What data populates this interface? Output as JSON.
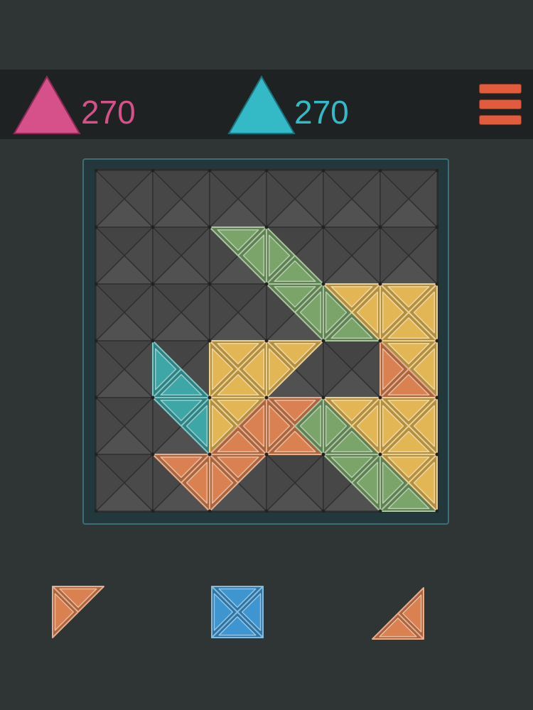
{
  "scores": {
    "player1": {
      "value": "270",
      "color": "#d6508a",
      "icon": "pink-triangle-icon"
    },
    "player2": {
      "value": "270",
      "color": "#34b9c6",
      "icon": "teal-triangle-icon"
    }
  },
  "menu": {
    "icon": "hamburger-menu-icon",
    "color": "#e05c3c"
  },
  "board": {
    "rows": 6,
    "cols": 6,
    "empty_color": "#4a4a4a",
    "colors": {
      "G": "#7aa46a",
      "Y": "#e2b654",
      "O": "#d98150",
      "T": "#3ea6a6"
    },
    "filled": [
      {
        "r": 1,
        "c": 2,
        "t": "top",
        "col": "G"
      },
      {
        "r": 1,
        "c": 2,
        "t": "right",
        "col": "G"
      },
      {
        "r": 1,
        "c": 3,
        "t": "left",
        "col": "G"
      },
      {
        "r": 1,
        "c": 3,
        "t": "bottom",
        "col": "G"
      },
      {
        "r": 2,
        "c": 3,
        "t": "top",
        "col": "G"
      },
      {
        "r": 2,
        "c": 3,
        "t": "right",
        "col": "G"
      },
      {
        "r": 2,
        "c": 4,
        "t": "left",
        "col": "G"
      },
      {
        "r": 2,
        "c": 4,
        "t": "bottom",
        "col": "G"
      },
      {
        "r": 2,
        "c": 4,
        "t": "top",
        "col": "Y"
      },
      {
        "r": 2,
        "c": 4,
        "t": "right",
        "col": "Y"
      },
      {
        "r": 2,
        "c": 5,
        "t": "top",
        "col": "Y"
      },
      {
        "r": 2,
        "c": 5,
        "t": "right",
        "col": "Y"
      },
      {
        "r": 2,
        "c": 5,
        "t": "bottom",
        "col": "Y"
      },
      {
        "r": 2,
        "c": 5,
        "t": "left",
        "col": "Y"
      },
      {
        "r": 3,
        "c": 1,
        "t": "left",
        "col": "T"
      },
      {
        "r": 3,
        "c": 1,
        "t": "bottom",
        "col": "T"
      },
      {
        "r": 3,
        "c": 2,
        "t": "top",
        "col": "Y"
      },
      {
        "r": 3,
        "c": 2,
        "t": "right",
        "col": "Y"
      },
      {
        "r": 3,
        "c": 2,
        "t": "bottom",
        "col": "Y"
      },
      {
        "r": 3,
        "c": 2,
        "t": "left",
        "col": "Y"
      },
      {
        "r": 3,
        "c": 3,
        "t": "top",
        "col": "Y"
      },
      {
        "r": 3,
        "c": 3,
        "t": "left",
        "col": "Y"
      },
      {
        "r": 3,
        "c": 5,
        "t": "top",
        "col": "Y"
      },
      {
        "r": 3,
        "c": 5,
        "t": "right",
        "col": "Y"
      },
      {
        "r": 3,
        "c": 5,
        "t": "left",
        "col": "O"
      },
      {
        "r": 3,
        "c": 5,
        "t": "bottom",
        "col": "O"
      },
      {
        "r": 4,
        "c": 1,
        "t": "top",
        "col": "T"
      },
      {
        "r": 4,
        "c": 1,
        "t": "right",
        "col": "T"
      },
      {
        "r": 4,
        "c": 2,
        "t": "top",
        "col": "Y"
      },
      {
        "r": 4,
        "c": 2,
        "t": "left",
        "col": "Y"
      },
      {
        "r": 4,
        "c": 2,
        "t": "right",
        "col": "O"
      },
      {
        "r": 4,
        "c": 2,
        "t": "bottom",
        "col": "O"
      },
      {
        "r": 4,
        "c": 3,
        "t": "top",
        "col": "O"
      },
      {
        "r": 4,
        "c": 3,
        "t": "left",
        "col": "O"
      },
      {
        "r": 4,
        "c": 3,
        "t": "bottom",
        "col": "O"
      },
      {
        "r": 4,
        "c": 3,
        "t": "right",
        "col": "G"
      },
      {
        "r": 4,
        "c": 4,
        "t": "left",
        "col": "G"
      },
      {
        "r": 4,
        "c": 4,
        "t": "bottom",
        "col": "G"
      },
      {
        "r": 4,
        "c": 4,
        "t": "top",
        "col": "Y"
      },
      {
        "r": 4,
        "c": 4,
        "t": "right",
        "col": "Y"
      },
      {
        "r": 4,
        "c": 5,
        "t": "top",
        "col": "Y"
      },
      {
        "r": 4,
        "c": 5,
        "t": "right",
        "col": "Y"
      },
      {
        "r": 4,
        "c": 5,
        "t": "bottom",
        "col": "Y"
      },
      {
        "r": 4,
        "c": 5,
        "t": "left",
        "col": "Y"
      },
      {
        "r": 5,
        "c": 1,
        "t": "top",
        "col": "O"
      },
      {
        "r": 5,
        "c": 1,
        "t": "right",
        "col": "O"
      },
      {
        "r": 5,
        "c": 2,
        "t": "top",
        "col": "O"
      },
      {
        "r": 5,
        "c": 2,
        "t": "left",
        "col": "O"
      },
      {
        "r": 5,
        "c": 4,
        "t": "top",
        "col": "G"
      },
      {
        "r": 5,
        "c": 4,
        "t": "right",
        "col": "G"
      },
      {
        "r": 5,
        "c": 5,
        "t": "left",
        "col": "G"
      },
      {
        "r": 5,
        "c": 5,
        "t": "bottom",
        "col": "G"
      },
      {
        "r": 5,
        "c": 5,
        "t": "top",
        "col": "Y"
      },
      {
        "r": 5,
        "c": 5,
        "t": "right",
        "col": "Y"
      }
    ]
  },
  "tray": [
    {
      "name": "tray-piece-orange-corner",
      "color": "#d98150",
      "tris": [
        "top",
        "left"
      ]
    },
    {
      "name": "tray-piece-blue-square",
      "color": "#3f95d0",
      "tris": [
        "top",
        "right",
        "bottom",
        "left"
      ]
    },
    {
      "name": "tray-piece-orange-corner-br",
      "color": "#d98150",
      "tris": [
        "right",
        "bottom"
      ]
    }
  ]
}
